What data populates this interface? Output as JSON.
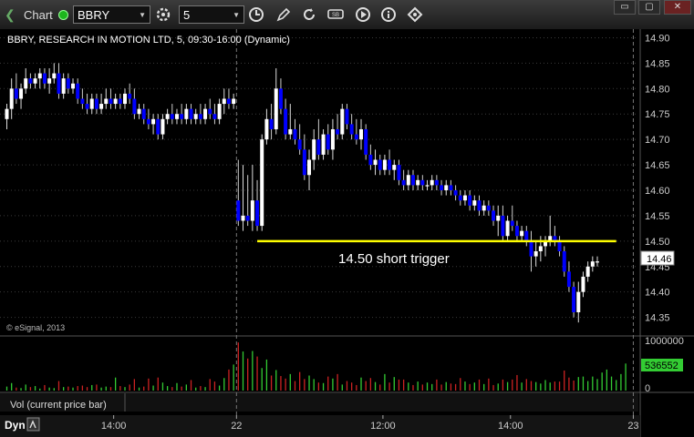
{
  "toolbar": {
    "title": "Chart",
    "symbol": "BBRY",
    "interval": "5",
    "icons": [
      "chevron-left-icon",
      "link-dot-icon",
      "symbol-dropdown-icon",
      "settings-gear-icon",
      "interval-dropdown-icon",
      "clock-icon",
      "pencil-icon",
      "refresh-icon",
      "study-icon",
      "play-icon",
      "info-icon",
      "drawing-tools-icon"
    ],
    "window_buttons": [
      "restore-icon",
      "close-icon"
    ]
  },
  "chart_data": {
    "type": "candlestick",
    "title": "BBRY, RESEARCH IN MOTION LTD, 5, 09:30-16:00 (Dynamic)",
    "copyright": "© eSignal, 2013",
    "y_ticks": [
      "14.90",
      "14.85",
      "14.80",
      "14.75",
      "14.70",
      "14.65",
      "14.60",
      "14.55",
      "14.50",
      "14.45",
      "14.40",
      "14.35"
    ],
    "ylim": [
      14.326,
      14.908
    ],
    "last_price": "14.46",
    "x_ticks": [
      {
        "label": "14:00",
        "bar": 23
      },
      {
        "label": "22",
        "bar": 49
      },
      {
        "label": "12:00",
        "bar": 80
      },
      {
        "label": "14:00",
        "bar": 107
      },
      {
        "label": "23",
        "bar": 133
      }
    ],
    "day_separators": [
      49,
      133
    ],
    "annotation": {
      "text": "14.50 short trigger",
      "price": 14.5,
      "from_bar": 53,
      "to_bar": 129,
      "color": "#ffff00"
    },
    "colors": {
      "up": "#ffffff",
      "down": "#0000ff",
      "vol_up": "#33cc33",
      "vol_down": "#cc2222",
      "grid": "#3a3a3a",
      "sep": "#777777"
    },
    "candles": [
      [
        14.74,
        14.77,
        14.72,
        14.76
      ],
      [
        14.76,
        14.82,
        14.74,
        14.8
      ],
      [
        14.8,
        14.83,
        14.77,
        14.78
      ],
      [
        14.78,
        14.81,
        14.76,
        14.8
      ],
      [
        14.8,
        14.84,
        14.79,
        14.82
      ],
      [
        14.82,
        14.83,
        14.8,
        14.81
      ],
      [
        14.81,
        14.83,
        14.8,
        14.82
      ],
      [
        14.82,
        14.84,
        14.8,
        14.83
      ],
      [
        14.83,
        14.84,
        14.8,
        14.81
      ],
      [
        14.81,
        14.84,
        14.79,
        14.82
      ],
      [
        14.82,
        14.85,
        14.81,
        14.83
      ],
      [
        14.83,
        14.85,
        14.78,
        14.79
      ],
      [
        14.79,
        14.83,
        14.78,
        14.82
      ],
      [
        14.82,
        14.83,
        14.79,
        14.8
      ],
      [
        14.8,
        14.82,
        14.79,
        14.81
      ],
      [
        14.81,
        14.82,
        14.77,
        14.78
      ],
      [
        14.78,
        14.8,
        14.76,
        14.77
      ],
      [
        14.77,
        14.79,
        14.75,
        14.76
      ],
      [
        14.76,
        14.79,
        14.75,
        14.78
      ],
      [
        14.78,
        14.79,
        14.75,
        14.76
      ],
      [
        14.76,
        14.79,
        14.75,
        14.77
      ],
      [
        14.77,
        14.8,
        14.76,
        14.78
      ],
      [
        14.78,
        14.8,
        14.76,
        14.77
      ],
      [
        14.77,
        14.79,
        14.76,
        14.78
      ],
      [
        14.78,
        14.79,
        14.76,
        14.77
      ],
      [
        14.77,
        14.8,
        14.76,
        14.79
      ],
      [
        14.79,
        14.81,
        14.77,
        14.78
      ],
      [
        14.78,
        14.8,
        14.74,
        14.75
      ],
      [
        14.75,
        14.77,
        14.74,
        14.76
      ],
      [
        14.76,
        14.77,
        14.73,
        14.74
      ],
      [
        14.74,
        14.76,
        14.72,
        14.73
      ],
      [
        14.73,
        14.75,
        14.71,
        14.74
      ],
      [
        14.74,
        14.75,
        14.7,
        14.71
      ],
      [
        14.71,
        14.75,
        14.7,
        14.74
      ],
      [
        14.74,
        14.76,
        14.73,
        14.75
      ],
      [
        14.75,
        14.77,
        14.73,
        14.74
      ],
      [
        14.74,
        14.76,
        14.73,
        14.75
      ],
      [
        14.75,
        14.77,
        14.73,
        14.74
      ],
      [
        14.74,
        14.77,
        14.73,
        14.76
      ],
      [
        14.76,
        14.77,
        14.73,
        14.74
      ],
      [
        14.74,
        14.76,
        14.73,
        14.75
      ],
      [
        14.75,
        14.77,
        14.73,
        14.74
      ],
      [
        14.74,
        14.77,
        14.73,
        14.76
      ],
      [
        14.76,
        14.78,
        14.74,
        14.75
      ],
      [
        14.75,
        14.77,
        14.73,
        14.74
      ],
      [
        14.74,
        14.78,
        14.73,
        14.77
      ],
      [
        14.77,
        14.8,
        14.75,
        14.78
      ],
      [
        14.78,
        14.8,
        14.76,
        14.77
      ],
      [
        14.77,
        14.79,
        14.76,
        14.78
      ],
      [
        14.58,
        14.66,
        14.53,
        14.54
      ],
      [
        14.54,
        14.65,
        14.52,
        14.55
      ],
      [
        14.55,
        14.63,
        14.53,
        14.54
      ],
      [
        14.54,
        14.65,
        14.52,
        14.58
      ],
      [
        14.58,
        14.62,
        14.52,
        14.53
      ],
      [
        14.53,
        14.71,
        14.52,
        14.7
      ],
      [
        14.7,
        14.76,
        14.69,
        14.74
      ],
      [
        14.74,
        14.77,
        14.7,
        14.72
      ],
      [
        14.72,
        14.84,
        14.71,
        14.8
      ],
      [
        14.8,
        14.82,
        14.75,
        14.76
      ],
      [
        14.76,
        14.78,
        14.7,
        14.71
      ],
      [
        14.71,
        14.77,
        14.7,
        14.72
      ],
      [
        14.72,
        14.74,
        14.69,
        14.7
      ],
      [
        14.7,
        14.73,
        14.67,
        14.68
      ],
      [
        14.68,
        14.71,
        14.62,
        14.63
      ],
      [
        14.63,
        14.68,
        14.6,
        14.66
      ],
      [
        14.66,
        14.72,
        14.64,
        14.7
      ],
      [
        14.7,
        14.74,
        14.66,
        14.67
      ],
      [
        14.67,
        14.72,
        14.66,
        14.71
      ],
      [
        14.71,
        14.73,
        14.67,
        14.68
      ],
      [
        14.68,
        14.74,
        14.66,
        14.72
      ],
      [
        14.72,
        14.75,
        14.7,
        14.71
      ],
      [
        14.71,
        14.77,
        14.7,
        14.76
      ],
      [
        14.76,
        14.77,
        14.72,
        14.73
      ],
      [
        14.73,
        14.75,
        14.7,
        14.71
      ],
      [
        14.71,
        14.74,
        14.69,
        14.7
      ],
      [
        14.7,
        14.74,
        14.68,
        14.72
      ],
      [
        14.72,
        14.73,
        14.66,
        14.67
      ],
      [
        14.67,
        14.69,
        14.64,
        14.65
      ],
      [
        14.65,
        14.68,
        14.63,
        14.66
      ],
      [
        14.66,
        14.67,
        14.63,
        14.64
      ],
      [
        14.64,
        14.67,
        14.63,
        14.66
      ],
      [
        14.66,
        14.68,
        14.63,
        14.64
      ],
      [
        14.64,
        14.66,
        14.62,
        14.65
      ],
      [
        14.65,
        14.66,
        14.61,
        14.62
      ],
      [
        14.62,
        14.64,
        14.6,
        14.61
      ],
      [
        14.61,
        14.64,
        14.6,
        14.63
      ],
      [
        14.63,
        14.64,
        14.6,
        14.61
      ],
      [
        14.61,
        14.63,
        14.6,
        14.62
      ],
      [
        14.62,
        14.63,
        14.6,
        14.61
      ],
      [
        14.61,
        14.62,
        14.6,
        14.61
      ],
      [
        14.61,
        14.63,
        14.6,
        14.62
      ],
      [
        14.62,
        14.63,
        14.6,
        14.61
      ],
      [
        14.61,
        14.62,
        14.59,
        14.6
      ],
      [
        14.6,
        14.62,
        14.59,
        14.61
      ],
      [
        14.61,
        14.62,
        14.59,
        14.6
      ],
      [
        14.6,
        14.61,
        14.58,
        14.59
      ],
      [
        14.59,
        14.6,
        14.57,
        14.58
      ],
      [
        14.58,
        14.6,
        14.57,
        14.59
      ],
      [
        14.59,
        14.6,
        14.56,
        14.57
      ],
      [
        14.57,
        14.59,
        14.56,
        14.58
      ],
      [
        14.58,
        14.59,
        14.55,
        14.56
      ],
      [
        14.56,
        14.58,
        14.55,
        14.57
      ],
      [
        14.57,
        14.58,
        14.55,
        14.56
      ],
      [
        14.56,
        14.57,
        14.53,
        14.54
      ],
      [
        14.54,
        14.57,
        14.51,
        14.55
      ],
      [
        14.55,
        14.57,
        14.5,
        14.51
      ],
      [
        14.51,
        14.55,
        14.5,
        14.54
      ],
      [
        14.54,
        14.57,
        14.52,
        14.53
      ],
      [
        14.53,
        14.54,
        14.5,
        14.51
      ],
      [
        14.51,
        14.53,
        14.5,
        14.52
      ],
      [
        14.52,
        14.53,
        14.49,
        14.5
      ],
      [
        14.5,
        14.52,
        14.44,
        14.47
      ],
      [
        14.47,
        14.5,
        14.45,
        14.48
      ],
      [
        14.48,
        14.51,
        14.46,
        14.49
      ],
      [
        14.49,
        14.51,
        14.47,
        14.5
      ],
      [
        14.5,
        14.55,
        14.49,
        14.51
      ],
      [
        14.51,
        14.53,
        14.49,
        14.5
      ],
      [
        14.5,
        14.51,
        14.47,
        14.48
      ],
      [
        14.48,
        14.49,
        14.43,
        14.44
      ],
      [
        14.44,
        14.46,
        14.4,
        14.41
      ],
      [
        14.41,
        14.42,
        14.35,
        14.36
      ],
      [
        14.36,
        14.42,
        14.34,
        14.4
      ],
      [
        14.4,
        14.44,
        14.39,
        14.43
      ],
      [
        14.43,
        14.46,
        14.42,
        14.45
      ],
      [
        14.45,
        14.47,
        14.44,
        14.46
      ],
      [
        14.46,
        14.47,
        14.45,
        14.46
      ]
    ],
    "volume": {
      "ticks": [
        "1000000",
        "0"
      ],
      "ymax": 1000000,
      "current": "536552",
      "label": "Vol (current price bar)",
      "values": [
        80000,
        150000,
        60000,
        50000,
        120000,
        70000,
        90000,
        40000,
        110000,
        60000,
        50000,
        190000,
        70000,
        80000,
        60000,
        90000,
        100000,
        70000,
        110000,
        120000,
        60000,
        80000,
        70000,
        260000,
        90000,
        70000,
        120000,
        230000,
        60000,
        80000,
        240000,
        100000,
        260000,
        160000,
        90000,
        70000,
        150000,
        80000,
        120000,
        210000,
        60000,
        90000,
        70000,
        230000,
        180000,
        100000,
        250000,
        420000,
        520000,
        960000,
        780000,
        640000,
        790000,
        680000,
        450000,
        620000,
        300000,
        410000,
        290000,
        240000,
        330000,
        190000,
        370000,
        230000,
        300000,
        230000,
        160000,
        150000,
        280000,
        240000,
        330000,
        120000,
        190000,
        160000,
        110000,
        260000,
        190000,
        250000,
        170000,
        120000,
        330000,
        160000,
        270000,
        220000,
        220000,
        160000,
        110000,
        180000,
        120000,
        160000,
        130000,
        220000,
        120000,
        170000,
        140000,
        130000,
        250000,
        180000,
        130000,
        160000,
        220000,
        130000,
        240000,
        110000,
        140000,
        220000,
        170000,
        220000,
        310000,
        160000,
        230000,
        190000,
        170000,
        140000,
        210000,
        160000,
        180000,
        180000,
        400000,
        260000,
        200000,
        270000,
        280000,
        190000,
        280000,
        230000,
        360000,
        420000,
        280000,
        210000,
        330000,
        540000
      ]
    }
  },
  "footer": {
    "mode": "Dyn"
  }
}
